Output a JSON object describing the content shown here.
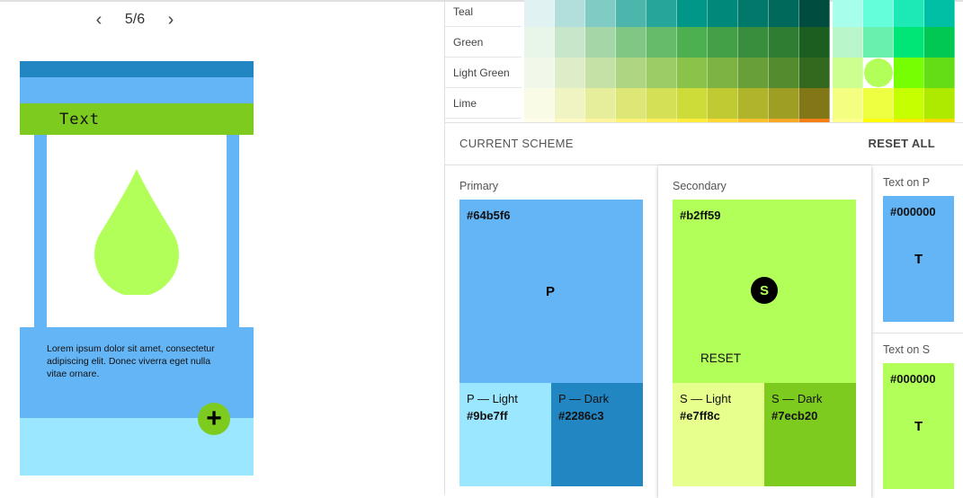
{
  "pager": {
    "prev_icon": "chevron-left-icon",
    "next_icon": "chevron-right-icon",
    "count": "5/6"
  },
  "preview": {
    "card_title": "Text",
    "body_text": "Lorem ipsum dolor sit amet, consectetur adipiscing elit. Donec viverra eget nulla vitae ornare.",
    "fab_icon": "+",
    "colors": {
      "primary": "#64b5f6",
      "primary_dark": "#2286c3",
      "primary_light": "#9be7ff",
      "secondary": "#b2ff59",
      "secondary_dark": "#7ecb20"
    }
  },
  "palette": {
    "rows": [
      {
        "label": "Teal",
        "colors": [
          "#e0f2f1",
          "#b2dfdb",
          "#80cbc4",
          "#4db6ac",
          "#26a69a",
          "#009688",
          "#00897b",
          "#00796b",
          "#00695c",
          "#004d40"
        ],
        "accents": [
          "#a7ffeb",
          "#64ffda",
          "#1de9b6",
          "#00bfa5"
        ]
      },
      {
        "label": "Green",
        "colors": [
          "#e8f5e9",
          "#c8e6c9",
          "#a5d6a7",
          "#81c784",
          "#66bb6a",
          "#4caf50",
          "#43a047",
          "#388e3c",
          "#2e7d32",
          "#1b5e20"
        ],
        "accents": [
          "#b9f6ca",
          "#69f0ae",
          "#00e676",
          "#00c853"
        ]
      },
      {
        "label": "Light Green",
        "colors": [
          "#f1f8e9",
          "#dcedc8",
          "#c5e1a5",
          "#aed581",
          "#9ccc65",
          "#8bc34a",
          "#7cb342",
          "#689f38",
          "#558b2f",
          "#33691e"
        ],
        "accents": [
          "#ccff90",
          "#b2ff59",
          "#76ff03",
          "#64dd17"
        ]
      },
      {
        "label": "Lime",
        "colors": [
          "#f9fbe7",
          "#f0f4c3",
          "#e6ee9c",
          "#dce775",
          "#d4e157",
          "#cddc39",
          "#c0ca33",
          "#afb42b",
          "#9e9d24",
          "#827717"
        ],
        "accents": [
          "#f4ff81",
          "#eeff41",
          "#c6ff00",
          "#aeea00"
        ]
      },
      {
        "label": "",
        "colors": [
          "#fffde7",
          "#fff9c4",
          "#fff59d",
          "#fff176",
          "#ffee58",
          "#ffeb3b",
          "#fdd835",
          "#fbc02d",
          "#f9a825",
          "#f57f17"
        ],
        "accents": [
          "#ffff8d",
          "#ffff00",
          "#ffea00",
          "#ffd600"
        ]
      }
    ],
    "selected": {
      "row": 2,
      "accent": 1
    }
  },
  "scheme": {
    "title": "CURRENT SCHEME",
    "reset_all": "RESET ALL",
    "primary": {
      "label": "Primary",
      "hex": "#64b5f6",
      "letter": "P",
      "light": {
        "name": "P — Light",
        "hex": "#9be7ff"
      },
      "dark": {
        "name": "P — Dark",
        "hex": "#2286c3"
      }
    },
    "secondary": {
      "label": "Secondary",
      "hex": "#b2ff59",
      "letter": "S",
      "reset": "RESET",
      "light": {
        "name": "S — Light",
        "hex": "#e7ff8c"
      },
      "dark": {
        "name": "S — Dark",
        "hex": "#7ecb20"
      }
    },
    "text_on_p": {
      "label": "Text on P",
      "hex": "#000000",
      "letter": "T"
    },
    "text_on_s": {
      "label": "Text on S",
      "hex": "#000000",
      "letter": "T"
    }
  }
}
